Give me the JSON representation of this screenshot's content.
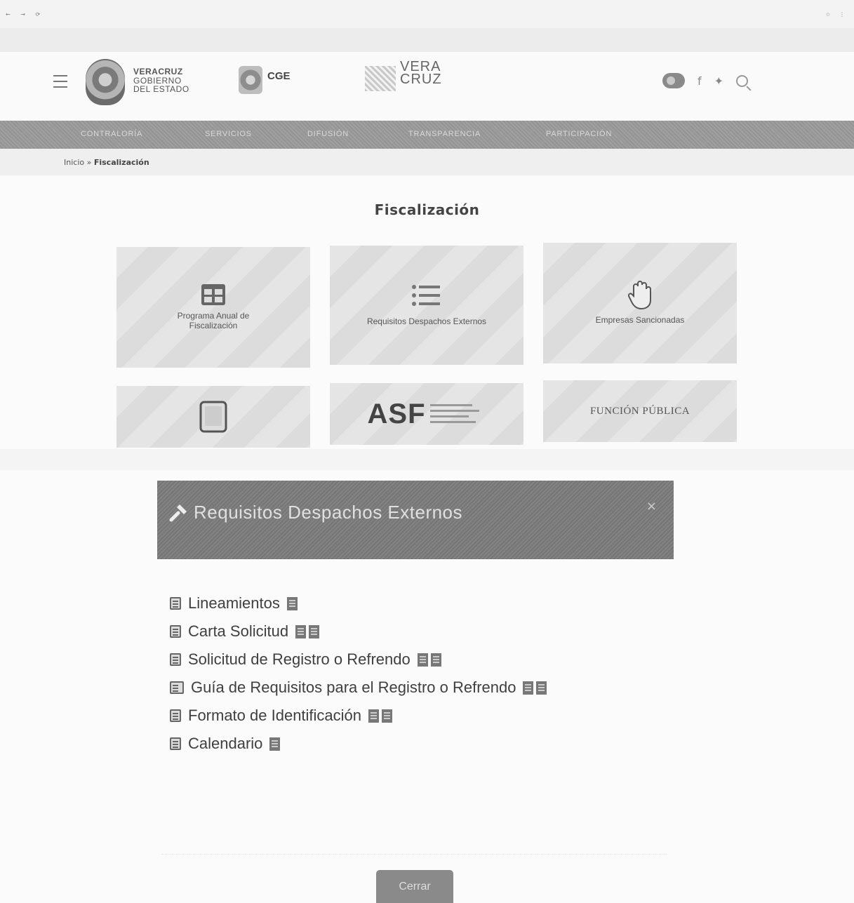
{
  "header": {
    "logo_line1": "VERACRUZ",
    "logo_line2": "GOBIERNO",
    "logo_line3": "DEL ESTADO",
    "cge": "CGE",
    "veracruz_brand_1": "VERA",
    "veracruz_brand_2": "CRUZ"
  },
  "nav": {
    "items": [
      "CONTRALORÍA",
      "SERVICIOS",
      "DIFUSIÓN",
      "TRANSPARENCIA",
      "PARTICIPACIÓN"
    ]
  },
  "breadcrumb": {
    "home": "Inicio",
    "separator": "»",
    "current": "Fiscalización"
  },
  "page": {
    "title": "Fiscalización"
  },
  "tiles": [
    {
      "label": "Programa Anual de Fiscalización",
      "icon": "calendar-grid-icon"
    },
    {
      "label": "Requisitos Despachos Externos",
      "icon": "checklist-icon"
    },
    {
      "label": "Empresas Sancionadas",
      "icon": "hand-stop-icon"
    },
    {
      "label": "",
      "icon": "tablet-icon"
    },
    {
      "label": "ASF",
      "icon": "asf-logo"
    },
    {
      "label": "FUNCIÓN PÚBLICA",
      "icon": "funcion-publica-logo"
    }
  ],
  "modal": {
    "title": "Requisitos Despachos Externos",
    "close_symbol": "×",
    "items": [
      {
        "label": "Lineamientos",
        "icon": "file-text-icon",
        "file_icons": 1
      },
      {
        "label": "Carta Solicitud",
        "icon": "file-icon",
        "file_icons": 2
      },
      {
        "label": "Solicitud de Registro o Refrendo",
        "icon": "file-icon",
        "file_icons": 2
      },
      {
        "label": "Guía de Requisitos para el Registro o Refrendo",
        "icon": "book-icon",
        "file_icons": 2
      },
      {
        "label": "Formato de Identificación",
        "icon": "id-card-icon",
        "file_icons": 2
      },
      {
        "label": "Calendario",
        "icon": "calendar-icon",
        "file_icons": 1
      }
    ],
    "close_button": "Cerrar"
  }
}
